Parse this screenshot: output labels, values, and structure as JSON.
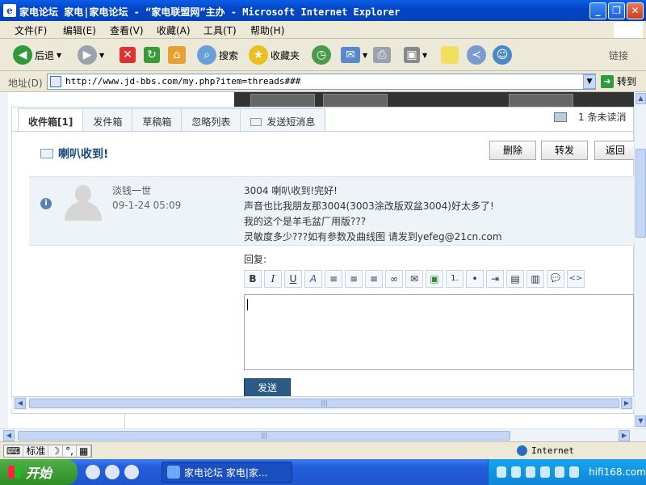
{
  "window": {
    "title": "家电论坛 家电|家电论坛 - “家电联盟网”主办 - Microsoft Internet Explorer",
    "app_icon": "e"
  },
  "menu": [
    "文件(F)",
    "编辑(E)",
    "查看(V)",
    "收藏(A)",
    "工具(T)",
    "帮助(H)"
  ],
  "toolbar": {
    "back": "后退",
    "search": "搜索",
    "favorites": "收藏夹",
    "links": "链接"
  },
  "address": {
    "label": "地址(D)",
    "url": "http://www.jd-bbs.com/my.php?item=threads###",
    "go": "转到"
  },
  "tabs": [
    "收件箱[1]",
    "发件箱",
    "草稿箱",
    "忽略列表",
    "发送短消息"
  ],
  "unread": {
    "count": "1",
    "text": "条未读消"
  },
  "message": {
    "title": "喇叭收到!",
    "actions": [
      "删除",
      "转发",
      "返回"
    ],
    "sender": "淡钱一世",
    "time": "09-1-24 05:09",
    "lines": [
      "3004 喇叭收到!完好!",
      "声音也比我朋友那3004(3003涂改版双盆3004)好太多了!",
      "我的这个是羊毛盆厂用版???",
      "灵敏度多少???如有参数及曲线图 请发到yefeg@21cn.com"
    ]
  },
  "reply": {
    "label": "回复:",
    "send": "发送"
  },
  "editor_buttons": [
    "B",
    "I",
    "U",
    "A",
    "≡",
    "≡",
    "≡",
    "∞",
    "✉",
    "▣",
    "1.",
    "•",
    "⇥",
    "▤",
    "▥",
    "💬",
    "<>"
  ],
  "status": {
    "ime": [
      "标准"
    ],
    "zone": "Internet"
  },
  "taskbar": {
    "start": "开始",
    "task": "家电论坛 家电|家...",
    "watermark": "hifi168.com"
  },
  "colors": {
    "title_bar": "#0a5fe6",
    "accent": "#1a4a7c",
    "send_button": "#2b5a84",
    "taskbar": "#245edb",
    "start": "#3a9a32"
  }
}
